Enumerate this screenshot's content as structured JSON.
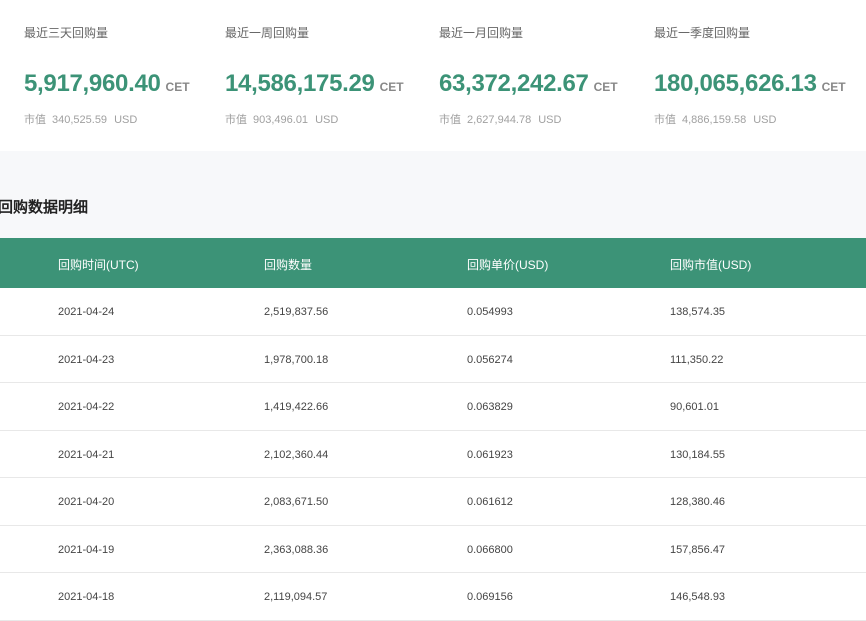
{
  "stats": [
    {
      "label": "最近三天回购量",
      "value": "5,917,960.40",
      "unit": "CET",
      "mv_label": "市值",
      "mv_value": "340,525.59",
      "mv_unit": "USD"
    },
    {
      "label": "最近一周回购量",
      "value": "14,586,175.29",
      "unit": "CET",
      "mv_label": "市值",
      "mv_value": "903,496.01",
      "mv_unit": "USD"
    },
    {
      "label": "最近一月回购量",
      "value": "63,372,242.67",
      "unit": "CET",
      "mv_label": "市值",
      "mv_value": "2,627,944.78",
      "mv_unit": "USD"
    },
    {
      "label": "最近一季度回购量",
      "value": "180,065,626.13",
      "unit": "CET",
      "mv_label": "市值",
      "mv_value": "4,886,159.58",
      "mv_unit": "USD"
    }
  ],
  "section_title": "回购数据明细",
  "table": {
    "headers": [
      "回购时间(UTC)",
      "回购数量",
      "回购单价(USD)",
      "回购市值(USD)"
    ],
    "rows": [
      [
        "2021-04-24",
        "2,519,837.56",
        "0.054993",
        "138,574.35"
      ],
      [
        "2021-04-23",
        "1,978,700.18",
        "0.056274",
        "111,350.22"
      ],
      [
        "2021-04-22",
        "1,419,422.66",
        "0.063829",
        "90,601.01"
      ],
      [
        "2021-04-21",
        "2,102,360.44",
        "0.061923",
        "130,184.55"
      ],
      [
        "2021-04-20",
        "2,083,671.50",
        "0.061612",
        "128,380.46"
      ],
      [
        "2021-04-19",
        "2,363,088.36",
        "0.066800",
        "157,856.47"
      ],
      [
        "2021-04-18",
        "2,119,094.57",
        "0.069156",
        "146,548.93"
      ]
    ]
  },
  "colors": {
    "accent": "#3c9377",
    "header_text": "#ffffff"
  }
}
